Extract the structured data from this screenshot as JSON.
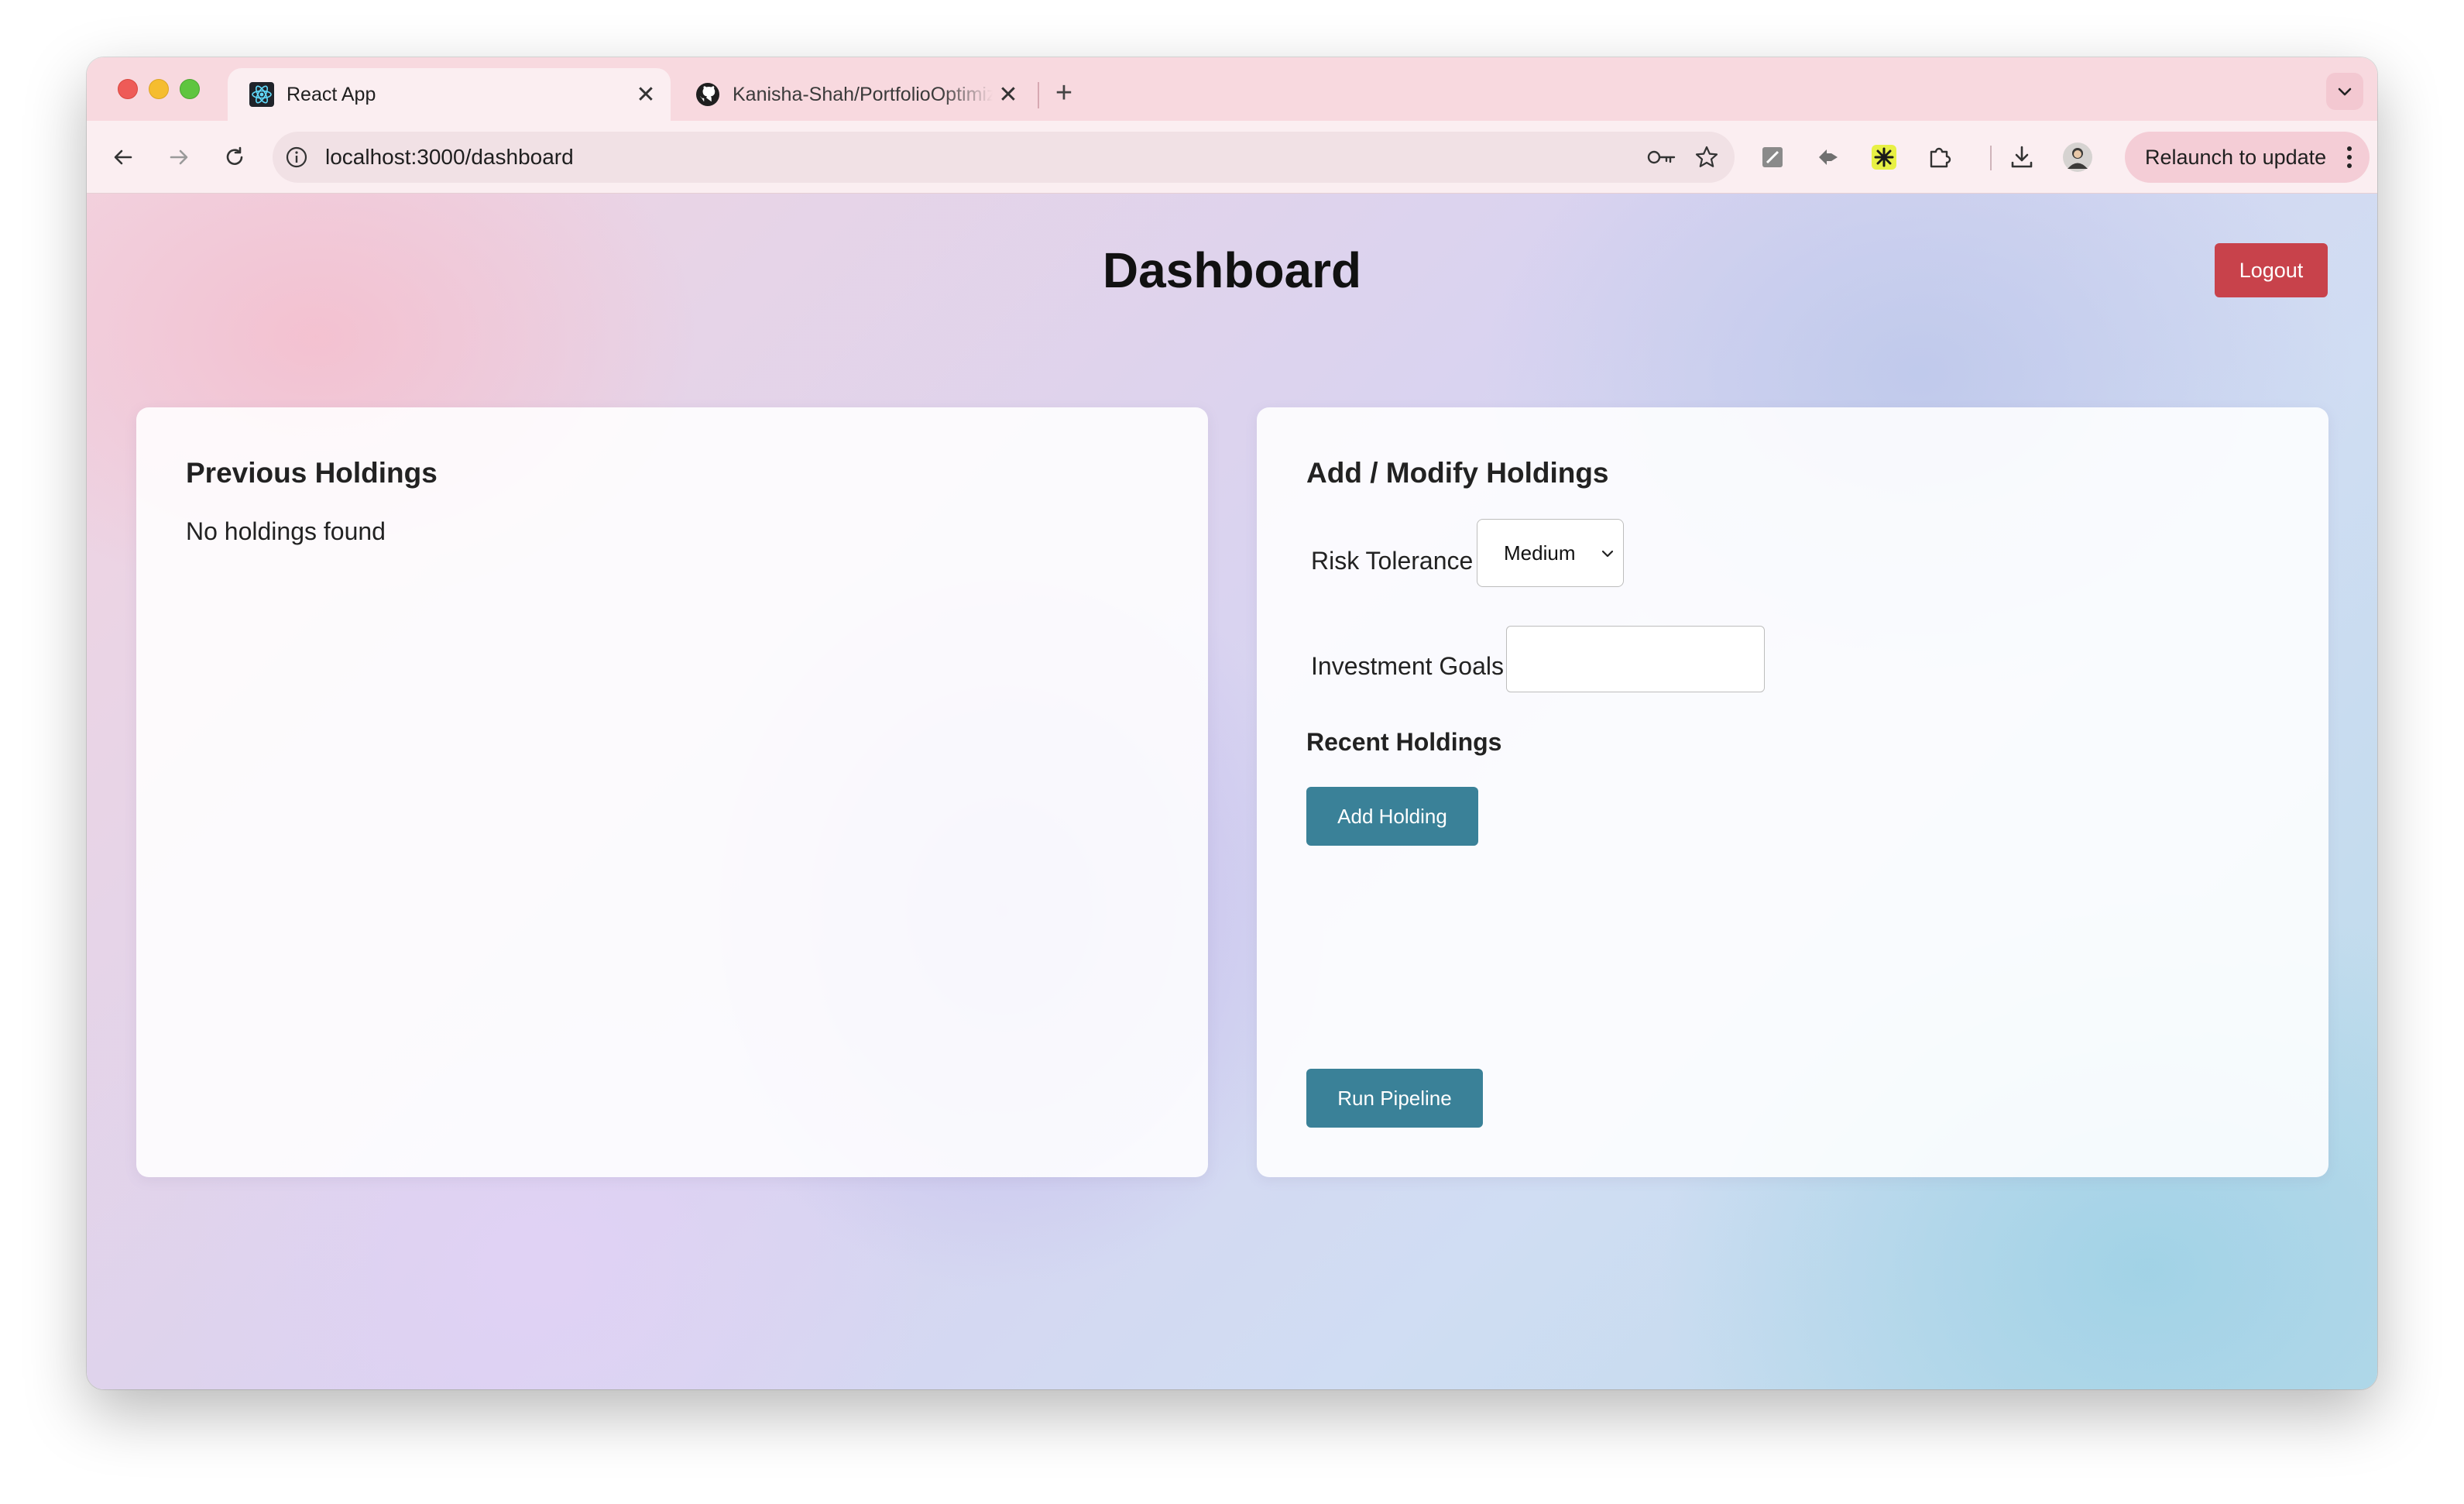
{
  "browser": {
    "tabs": [
      {
        "title": "React App",
        "icon": "react-icon",
        "active": true
      },
      {
        "title": "Kanisha-Shah/PortfolioOptimization",
        "icon": "github-icon",
        "active": false
      }
    ],
    "url": "localhost:3000/dashboard",
    "relaunch_label": "Relaunch to update"
  },
  "page": {
    "title": "Dashboard",
    "logout_label": "Logout"
  },
  "previous_holdings": {
    "heading": "Previous Holdings",
    "empty_text": "No holdings found"
  },
  "modify_holdings": {
    "heading": "Add / Modify Holdings",
    "risk_label": "Risk Tolerance",
    "risk_value": "Medium",
    "goals_label": "Investment Goals",
    "goals_value": "",
    "recent_heading": "Recent Holdings",
    "add_button": "Add Holding",
    "run_button": "Run Pipeline"
  },
  "colors": {
    "logout": "#c8424b",
    "primary_button": "#3a8198",
    "tabstrip": "#f8d9df"
  }
}
